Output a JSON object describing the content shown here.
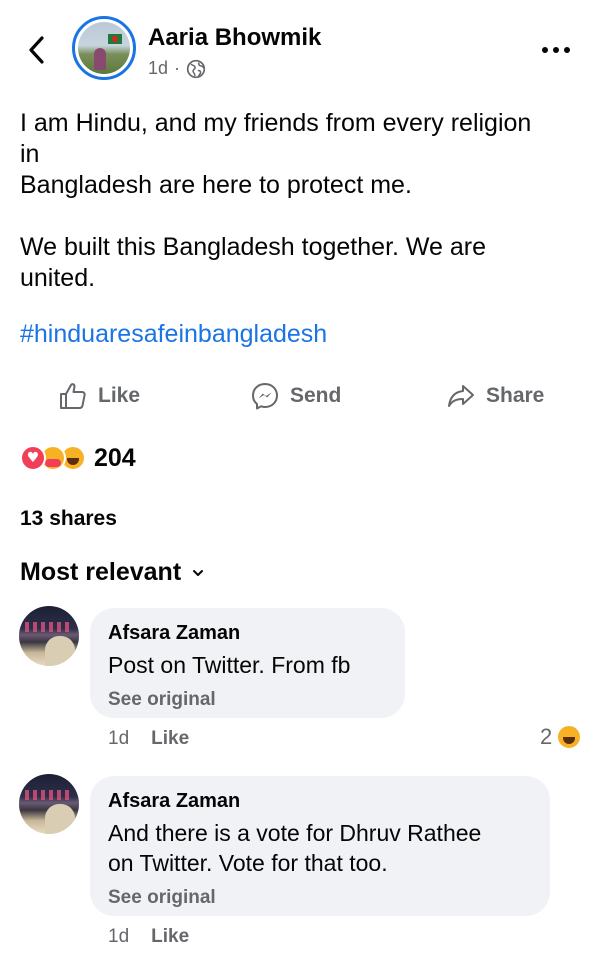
{
  "header": {
    "author_name": "Aaria Bhowmik",
    "post_time": "1d",
    "separator": "·",
    "privacy_icon": "globe-icon",
    "back_icon": "chevron-left-icon",
    "more_icon": "more-dots-icon"
  },
  "post": {
    "lines": [
      "I am Hindu, and my friends from every religion",
      "in",
      "Bangladesh are here to protect me.",
      "",
      "We built this Bangladesh together. We are",
      "united."
    ],
    "hashtag": "#hinduaresafeinbangladesh"
  },
  "actions": {
    "like": "Like",
    "send": "Send",
    "share": "Share"
  },
  "reactions": {
    "types": [
      "love",
      "care",
      "haha"
    ],
    "count": "204"
  },
  "shares": "13 shares",
  "comments_sort": "Most relevant",
  "comments": [
    {
      "author": "Afsara Zaman",
      "lines": [
        "Post on Twitter. From fb"
      ],
      "see_original": "See original",
      "time": "1d",
      "like": "Like",
      "reaction_count": "2",
      "reaction_type": "haha"
    },
    {
      "author": "Afsara Zaman",
      "lines": [
        "And there is a vote for Dhruv Rathee",
        "on Twitter. Vote for that too."
      ],
      "see_original": "See original",
      "time": "1d",
      "like": "Like"
    }
  ],
  "colors": {
    "accent": "#1b74e4",
    "secondary_text": "#65676b",
    "bubble": "#f0f2f5",
    "love": "#f33e58",
    "yellow": "#f7b125"
  }
}
